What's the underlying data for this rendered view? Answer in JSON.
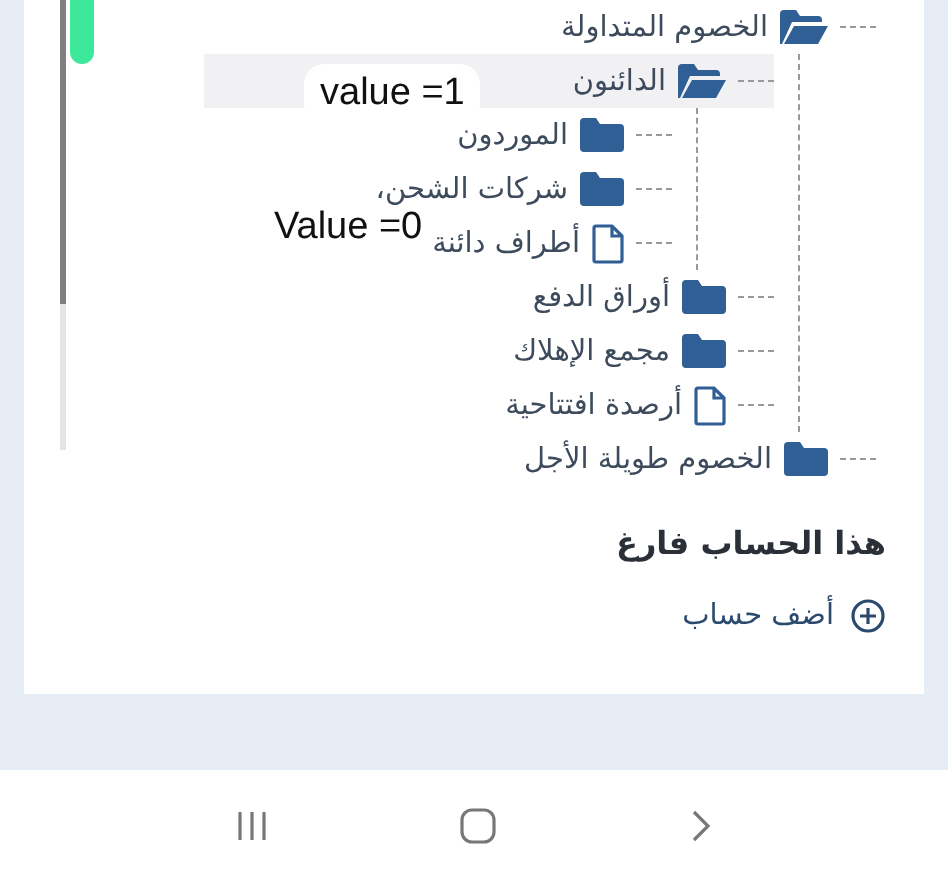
{
  "tree": [
    {
      "label": "الخصوم المتداولة",
      "kind": "folder",
      "expanded": true,
      "selected": false,
      "children": [
        {
          "label": "الدائنون",
          "kind": "folder",
          "expanded": true,
          "selected": true,
          "children": [
            {
              "label": "الموردون",
              "kind": "folder",
              "expanded": false,
              "selected": false
            },
            {
              "label": "شركات الشحن،",
              "kind": "folder",
              "expanded": false,
              "selected": false
            },
            {
              "label": "أطراف دائنة",
              "kind": "file",
              "selected": false
            }
          ]
        },
        {
          "label": "أوراق الدفع",
          "kind": "folder",
          "expanded": false,
          "selected": false
        },
        {
          "label": "مجمع الإهلاك",
          "kind": "folder",
          "expanded": false,
          "selected": false
        },
        {
          "label": "أرصدة افتتاحية",
          "kind": "file",
          "selected": false
        }
      ]
    },
    {
      "label": "الخصوم طويلة الأجل",
      "kind": "folder",
      "expanded": false,
      "selected": false
    }
  ],
  "annotations": [
    "value =1",
    "Value =0"
  ],
  "empty_message": "هذا الحساب فارغ",
  "add_account_link": "أضف حساب"
}
